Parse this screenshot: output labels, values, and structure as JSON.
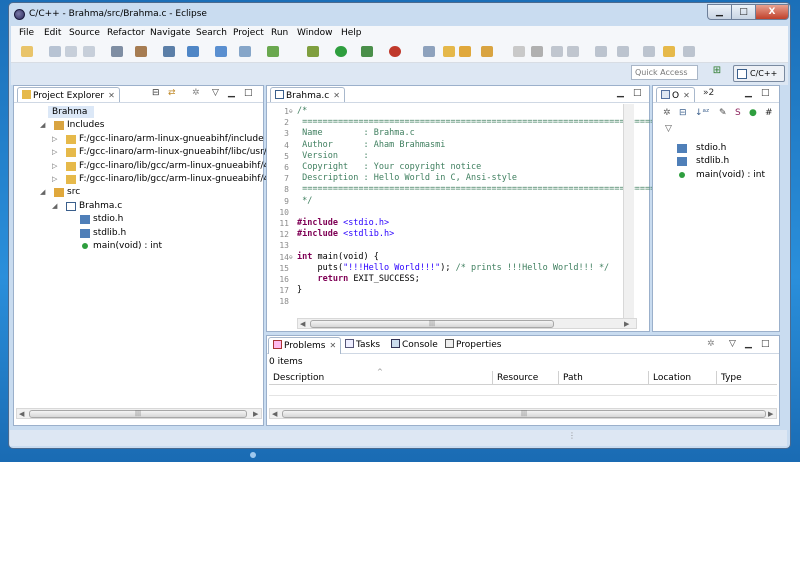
{
  "window": {
    "title": "C/C++ - Brahma/src/Brahma.c - Eclipse"
  },
  "window_controls": {
    "minimize": "▁",
    "maximize": "□",
    "close": "X"
  },
  "menu": [
    "File",
    "Edit",
    "Source",
    "Refactor",
    "Navigate",
    "Search",
    "Project",
    "Run",
    "Window",
    "Help"
  ],
  "quick_access": {
    "placeholder": "Quick Access"
  },
  "perspective": {
    "label": "C/C++"
  },
  "project_explorer": {
    "title": "Project Explorer",
    "tree": [
      {
        "label": "Brahma",
        "level": 0,
        "expanded": true,
        "icon": "project-icon"
      },
      {
        "label": "Includes",
        "level": 1,
        "expanded": true,
        "icon": "includes-icon"
      },
      {
        "label": "F:/gcc-linaro/arm-linux-gnueabihf/include",
        "level": 2,
        "expanded": false,
        "icon": "include-folder-icon"
      },
      {
        "label": "F:/gcc-linaro/arm-linux-gnueabihf/libc/usr/in",
        "level": 2,
        "expanded": false,
        "icon": "include-folder-icon"
      },
      {
        "label": "F:/gcc-linaro/lib/gcc/arm-linux-gnueabihf/4.9",
        "level": 2,
        "expanded": false,
        "icon": "include-folder-icon"
      },
      {
        "label": "F:/gcc-linaro/lib/gcc/arm-linux-gnueabihf/4.9",
        "level": 2,
        "expanded": false,
        "icon": "include-folder-icon"
      },
      {
        "label": "src",
        "level": 1,
        "expanded": true,
        "icon": "source-folder-icon"
      },
      {
        "label": "Brahma.c",
        "level": 2,
        "expanded": true,
        "icon": "c-file-icon"
      },
      {
        "label": "stdio.h",
        "level": 3,
        "expanded": false,
        "icon": "include-icon"
      },
      {
        "label": "stdlib.h",
        "level": 3,
        "expanded": false,
        "icon": "include-icon"
      },
      {
        "label": "main(void) : int",
        "level": 3,
        "expanded": false,
        "icon": "function-icon"
      }
    ]
  },
  "editor": {
    "tab": "Brahma.c",
    "lines": [
      {
        "n": "1",
        "text": "/*",
        "cls": "cm"
      },
      {
        "n": "2",
        "text": " ============================================================================",
        "cls": "cm"
      },
      {
        "n": "3",
        "text": " Name        : Brahma.c",
        "cls": "cm"
      },
      {
        "n": "4",
        "text": " Author      : Aham Brahmasmi",
        "cls": "cm"
      },
      {
        "n": "5",
        "text": " Version     :",
        "cls": "cm"
      },
      {
        "n": "6",
        "text": " Copyright   : Your copyright notice",
        "cls": "cm"
      },
      {
        "n": "7",
        "text": " Description : Hello World in C, Ansi-style",
        "cls": "cm"
      },
      {
        "n": "8",
        "text": " ============================================================================",
        "cls": "cm"
      },
      {
        "n": "9",
        "text": " */",
        "cls": "cm"
      },
      {
        "n": "10",
        "text": "",
        "cls": ""
      },
      {
        "n": "11",
        "text": "#include <stdio.h>",
        "cls": "pp"
      },
      {
        "n": "12",
        "text": "#include <stdlib.h>",
        "cls": "pp"
      },
      {
        "n": "13",
        "text": "",
        "cls": ""
      },
      {
        "n": "14",
        "text": "int main(void) {",
        "cls": "main"
      },
      {
        "n": "15",
        "text": "\tputs(\"!!!Hello World!!!\"); /* prints !!!Hello World!!! */",
        "cls": "puts"
      },
      {
        "n": "16",
        "text": "\treturn EXIT_SUCCESS;",
        "cls": "ret"
      },
      {
        "n": "17",
        "text": "}",
        "cls": ""
      },
      {
        "n": "18",
        "text": "",
        "cls": ""
      }
    ]
  },
  "outline": {
    "tabs": [
      "O",
      "»2"
    ],
    "items": [
      {
        "label": "stdio.h",
        "icon": "include-icon"
      },
      {
        "label": "stdlib.h",
        "icon": "include-icon"
      },
      {
        "label": "main(void) : int",
        "icon": "function-icon"
      }
    ]
  },
  "bottom_panel": {
    "tabs": [
      {
        "label": "Problems",
        "icon": "problems-icon",
        "active": true
      },
      {
        "label": "Tasks",
        "icon": "tasks-icon"
      },
      {
        "label": "Console",
        "icon": "console-icon"
      },
      {
        "label": "Properties",
        "icon": "properties-icon"
      }
    ],
    "item_count": "0 items",
    "columns": [
      "Description",
      "Resource",
      "Path",
      "Location",
      "Type"
    ]
  },
  "colors": {
    "comment": "#3f7f5f",
    "keyword": "#7f0055",
    "string": "#2a00ff",
    "window_frame": "#c9dcf0",
    "desktop": "#2a8fdb"
  }
}
